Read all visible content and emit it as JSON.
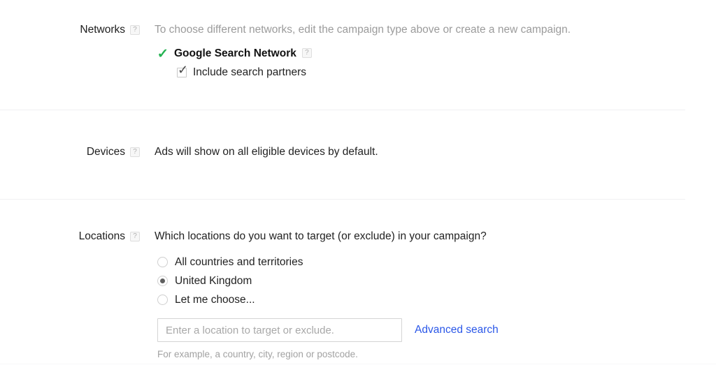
{
  "networks": {
    "label": "Networks",
    "help_icon": "help-question-icon",
    "description": "To choose different networks, edit the campaign type above or create a new campaign.",
    "selected_network": {
      "check_icon": "green-checkmark-icon",
      "name": "Google Search Network",
      "help_icon": "help-question-icon"
    },
    "include_partners": {
      "label": "Include search partners",
      "checked": true
    }
  },
  "devices": {
    "label": "Devices",
    "help_icon": "help-question-icon",
    "description": "Ads will show on all eligible devices by default."
  },
  "locations": {
    "label": "Locations",
    "help_icon": "help-question-icon",
    "question": "Which locations do you want to target (or exclude) in your campaign?",
    "options": [
      {
        "label": "All countries and territories",
        "selected": false
      },
      {
        "label": "United Kingdom",
        "selected": true
      },
      {
        "label": "Let me choose...",
        "selected": false
      }
    ],
    "search": {
      "value": "",
      "placeholder": "Enter a location to target or exclude.",
      "advanced_link": "Advanced search",
      "hint": "For example, a country, city, region or postcode."
    }
  },
  "colors": {
    "link": "#2a57e8",
    "check": "#24b352",
    "muted": "#9b9b9b",
    "divider": "#f0f0f2"
  }
}
